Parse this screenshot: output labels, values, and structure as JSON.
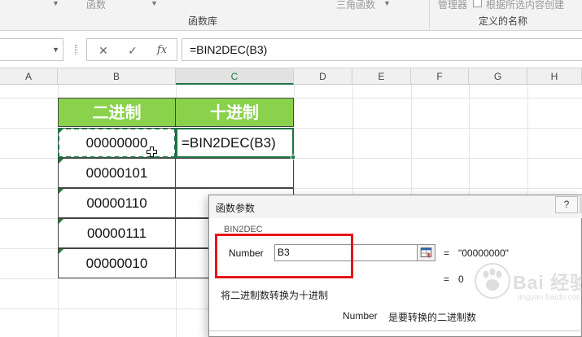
{
  "ribbon": {
    "cut_labels": [
      "函数",
      "三角函数",
      "管理器",
      "根据所选内容创建"
    ],
    "group_labels": [
      "函数库",
      "定义的名称"
    ]
  },
  "formula_bar": {
    "name_box": "",
    "cancel_icon": "✕",
    "enter_icon": "✓",
    "insert_function_icon": "fx",
    "formula": "=BIN2DEC(B3)"
  },
  "columns": [
    "A",
    "B",
    "C",
    "D",
    "E",
    "F",
    "G",
    "H"
  ],
  "selected_column": "C",
  "table": {
    "headers": [
      "二进制",
      "十进制"
    ],
    "rows": [
      "00000000",
      "00000101",
      "00000110",
      "00000111",
      "00000010"
    ],
    "editing_cell_text": "=BIN2DEC(B3)"
  },
  "dialog": {
    "title": "函数参数",
    "help_label": "?",
    "function_name": "BIN2DEC",
    "argument_label": "Number",
    "argument_value": "B3",
    "equals": "=",
    "argument_result": "\"00000000\"",
    "formula_result": "0",
    "description": "将二进制数转换为十进制",
    "arg_help_name": "Number",
    "arg_help_text": "是要转换的二进制数"
  },
  "watermark": {
    "text": "Bai 经验",
    "sub": "jingyan.baidu.com"
  },
  "colors": {
    "header_green": "#8ad14c",
    "excel_green": "#217346",
    "highlight_red": "#e8141b"
  },
  "icons": [
    "cancel-icon",
    "enter-icon",
    "insert-function-icon",
    "collapse-dialog-icon",
    "cell-cursor-icon",
    "help-icon",
    "paw-icon"
  ]
}
